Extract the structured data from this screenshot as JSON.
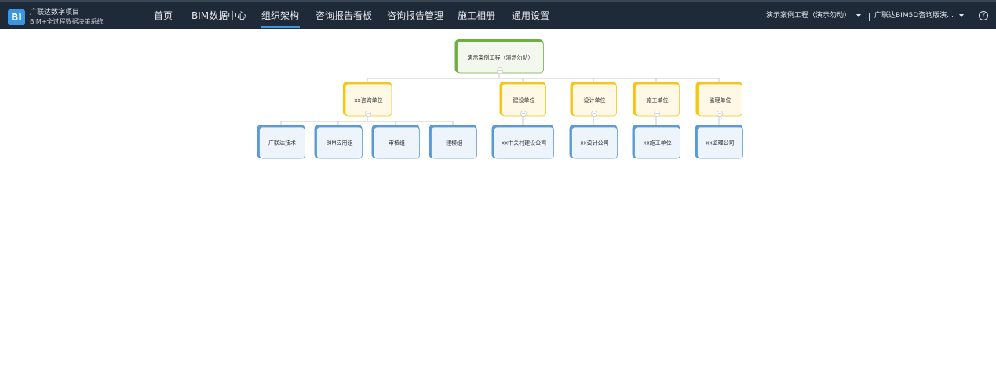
{
  "app": {
    "logo_text": "BI",
    "title": "广联达数字项目",
    "subtitle": "BIM+全过程数据决策系统"
  },
  "nav": [
    {
      "label": "首页"
    },
    {
      "label": "BIM数据中心"
    },
    {
      "label": "组织架构",
      "active": true
    },
    {
      "label": "咨询报告看板"
    },
    {
      "label": "咨询报告管理"
    },
    {
      "label": "施工相册"
    },
    {
      "label": "通用设置"
    }
  ],
  "header_right": {
    "project_select": "演示案例工程（演示勿动）",
    "org_select": "广联达BIM5D咨询版演...",
    "help_symbol": "?"
  },
  "org": {
    "root": {
      "label": "演示案例工程（演示勿动）"
    },
    "units": [
      {
        "label": "xx咨询单位",
        "children": [
          "广联达技术",
          "BIM应用组",
          "审核组",
          "建模组"
        ]
      },
      {
        "label": "建设单位",
        "children": [
          "xx中关村建设公司"
        ]
      },
      {
        "label": "设计单位",
        "children": [
          "xx设计公司"
        ]
      },
      {
        "label": "施工单位",
        "children": [
          "xx施工单位"
        ]
      },
      {
        "label": "监理单位",
        "children": [
          "xx监理公司"
        ]
      }
    ],
    "colors": {
      "root_accent": "#6fae44",
      "root_fill": "#f3f8ee",
      "unit_accent": "#f5c518",
      "unit_fill": "#fdf9e6",
      "leaf_accent": "#5b9bd5",
      "leaf_fill": "#eef4fb",
      "connector": "#c9c9c9"
    }
  }
}
